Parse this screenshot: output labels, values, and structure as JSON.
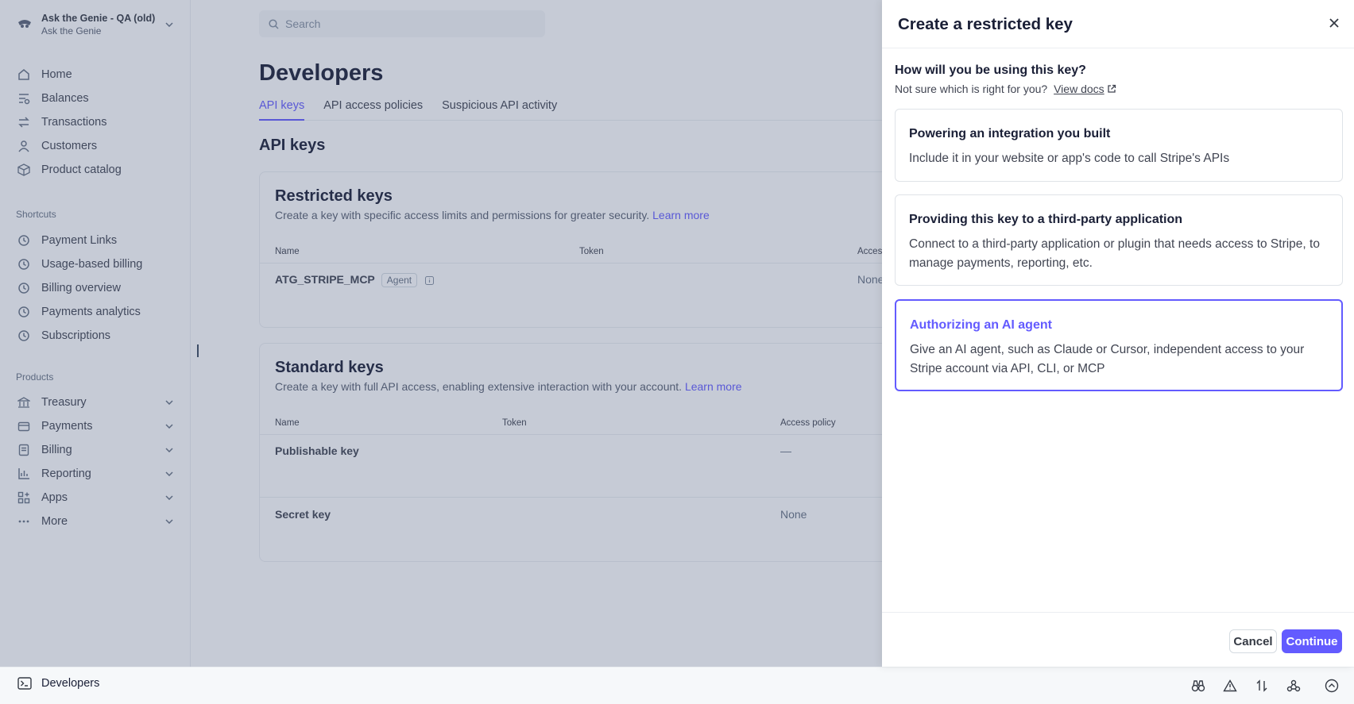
{
  "account": {
    "name": "Ask the Genie - QA (old)",
    "subname": "Ask the Genie"
  },
  "search": {
    "placeholder": "Search"
  },
  "sidebar": {
    "main_items": [
      {
        "label": "Home",
        "icon": "home-icon"
      },
      {
        "label": "Balances",
        "icon": "balances-icon"
      },
      {
        "label": "Transactions",
        "icon": "transactions-icon"
      },
      {
        "label": "Customers",
        "icon": "customers-icon"
      },
      {
        "label": "Product catalog",
        "icon": "product-catalog-icon"
      }
    ],
    "shortcuts_label": "Shortcuts",
    "shortcuts": [
      {
        "label": "Payment Links",
        "icon": "clock-icon"
      },
      {
        "label": "Usage-based billing",
        "icon": "clock-icon"
      },
      {
        "label": "Billing overview",
        "icon": "clock-icon"
      },
      {
        "label": "Payments analytics",
        "icon": "clock-icon"
      },
      {
        "label": "Subscriptions",
        "icon": "clock-icon"
      }
    ],
    "products_label": "Products",
    "products": [
      {
        "label": "Treasury",
        "icon": "treasury-icon"
      },
      {
        "label": "Payments",
        "icon": "payments-icon"
      },
      {
        "label": "Billing",
        "icon": "billing-icon"
      },
      {
        "label": "Reporting",
        "icon": "reporting-icon"
      },
      {
        "label": "Apps",
        "icon": "apps-icon"
      },
      {
        "label": "More",
        "icon": "more-icon"
      }
    ]
  },
  "page": {
    "title": "Developers",
    "tabs": [
      "API keys",
      "API access policies",
      "Suspicious API activity"
    ],
    "section_title": "API keys"
  },
  "restricted": {
    "title": "Restricted keys",
    "desc": "Create a key with specific access limits and permissions for greater security.",
    "learn_more": "Learn more",
    "columns": [
      "Name",
      "Token",
      "Access"
    ],
    "row": {
      "name": "ATG_STRIPE_MCP",
      "badge": "Agent",
      "access": "None"
    }
  },
  "standard": {
    "title": "Standard keys",
    "desc": "Create a key with full API access, enabling extensive interaction with your account.",
    "learn_more": "Learn more",
    "columns": [
      "Name",
      "Token",
      "Access policy"
    ],
    "rows": [
      {
        "name": "Publishable key",
        "access": "—"
      },
      {
        "name": "Secret key",
        "access": "None"
      }
    ]
  },
  "bottombar": {
    "label": "Developers"
  },
  "drawer": {
    "title": "Create a restricted key",
    "question": "How will you be using this key?",
    "hint": "Not sure which is right for you?",
    "docs_link": "View docs",
    "options": [
      {
        "title": "Powering an integration you built",
        "desc": "Include it in your website or app's code to call Stripe's APIs"
      },
      {
        "title": "Providing this key to a third-party application",
        "desc": "Connect to a third-party application or plugin that needs access to Stripe, to manage payments, reporting, etc."
      },
      {
        "title": "Authorizing an AI agent",
        "desc": "Give an AI agent, such as Claude or Cursor, independent access to your Stripe account via API, CLI, or MCP"
      }
    ],
    "selected_option": "Authorizing an AI agent",
    "cancel": "Cancel",
    "continue": "Continue"
  },
  "colors": {
    "accent": "#635bff",
    "overlay": "rgba(66,84,120,0.30)"
  }
}
